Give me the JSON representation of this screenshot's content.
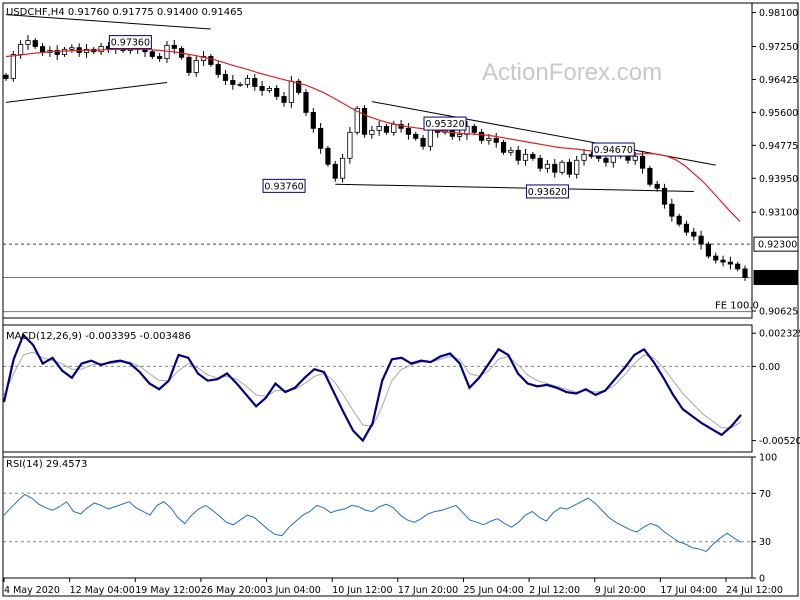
{
  "chart_data": [
    {
      "type": "candlestick",
      "title": "USDCHF,H4  0.91760 0.91775 0.91400 0.91465",
      "watermark": "ActionForex.com",
      "ylim": [
        0.9045,
        0.9834
      ],
      "yticks": [
        "0.98100",
        "0.97250",
        "0.96425",
        "0.95600",
        "0.94775",
        "0.93950",
        "0.93100",
        "0.90625"
      ],
      "ytick_values": [
        0.981,
        0.9725,
        0.96425,
        0.956,
        0.94775,
        0.9395,
        0.931,
        0.90625
      ],
      "xticks": [
        "4 May 2020",
        "12 May 04:00",
        "19 May 12:00",
        "26 May 20:00",
        "3 Jun 04:00",
        "10 Jun 12:00",
        "17 Jun 20:00",
        "25 Jun 04:00",
        "2 Jul 12:00",
        "9 Jul 20:00",
        "17 Jul 04:00",
        "24 Jul 12:00"
      ],
      "price_labels": [
        {
          "text": "0.92300",
          "value": 0.923,
          "style": "boxed"
        },
        {
          "text": "0.91465",
          "value": 0.91465,
          "style": "current"
        }
      ],
      "level_lines": [
        {
          "value": 0.923,
          "style": "dashed"
        },
        {
          "value": 0.91465,
          "style": "solid"
        },
        {
          "value": 0.9061,
          "style": "solid",
          "label": "FE 100.0"
        }
      ],
      "annotations": [
        {
          "text": "0.97360",
          "x": 17,
          "value": 0.9736
        },
        {
          "text": "0.95320",
          "x": 60,
          "value": 0.9532
        },
        {
          "text": "0.93760",
          "x": 38,
          "value": 0.9376
        },
        {
          "text": "0.93620",
          "x": 74,
          "value": 0.9362
        },
        {
          "text": "0.94670",
          "x": 83,
          "value": 0.9467
        }
      ],
      "trendlines": [
        {
          "name": "upper-triangle",
          "from": [
            0,
            0.9805
          ],
          "to": [
            28,
            0.9769
          ]
        },
        {
          "name": "lower-triangle",
          "from": [
            0,
            0.9585
          ],
          "to": [
            22,
            0.9635
          ]
        },
        {
          "name": "falling-resistance",
          "from": [
            50,
            0.9587
          ],
          "to": [
            97,
            0.9428
          ]
        },
        {
          "name": "support",
          "from": [
            45,
            0.938
          ],
          "to": [
            94,
            0.9362
          ]
        }
      ],
      "series": [
        {
          "name": "Close",
          "values": [
            0.9645,
            0.9705,
            0.973,
            0.974,
            0.9725,
            0.971,
            0.9715,
            0.9705,
            0.9718,
            0.9722,
            0.971,
            0.9718,
            0.9712,
            0.9725,
            0.972,
            0.9728,
            0.9715,
            0.9718,
            0.9725,
            0.9712,
            0.97,
            0.9695,
            0.9728,
            0.972,
            0.9698,
            0.966,
            0.969,
            0.97,
            0.968,
            0.9655,
            0.964,
            0.963,
            0.963,
            0.9645,
            0.9625,
            0.9615,
            0.962,
            0.96,
            0.9585,
            0.9638,
            0.961,
            0.956,
            0.952,
            0.947,
            0.943,
            0.9395,
            0.9445,
            0.951,
            0.957,
            0.9505,
            0.9515,
            0.9525,
            0.951,
            0.953,
            0.952,
            0.9505,
            0.9495,
            0.9475,
            0.952,
            0.951,
            0.9515,
            0.95,
            0.9505,
            0.9525,
            0.951,
            0.949,
            0.9495,
            0.9485,
            0.946,
            0.9465,
            0.944,
            0.9455,
            0.9445,
            0.942,
            0.943,
            0.941,
            0.9435,
            0.9405,
            0.944,
            0.9455,
            0.945,
            0.9445,
            0.9435,
            0.9455,
            0.945,
            0.944,
            0.945,
            0.942,
            0.938,
            0.937,
            0.933,
            0.93,
            0.928,
            0.926,
            0.925,
            0.923,
            0.92,
            0.919,
            0.9185,
            0.918,
            0.9168,
            0.91465
          ]
        },
        {
          "name": "MA",
          "color": "#e02020",
          "values": [
            0.97,
            0.9702,
            0.9705,
            0.9708,
            0.971,
            0.9712,
            0.9713,
            0.9714,
            0.9715,
            0.9716,
            0.9716,
            0.9717,
            0.9718,
            0.9718,
            0.9718,
            0.9718,
            0.9717,
            0.9715,
            0.9713,
            0.971,
            0.9706,
            0.9702,
            0.9697,
            0.9692,
            0.9685,
            0.9678,
            0.9672,
            0.9665,
            0.9658,
            0.9652,
            0.9646,
            0.964,
            0.9635,
            0.9629,
            0.962,
            0.961,
            0.9598,
            0.9585,
            0.9572,
            0.956,
            0.955,
            0.9542,
            0.9535,
            0.953,
            0.9525,
            0.9522,
            0.9519,
            0.9516,
            0.9513,
            0.951,
            0.9508,
            0.9506,
            0.9505,
            0.9503,
            0.95,
            0.9496,
            0.9492,
            0.9488,
            0.9484,
            0.948,
            0.9476,
            0.9472,
            0.947,
            0.9468,
            0.9465,
            0.9462,
            0.946,
            0.9458,
            0.9456,
            0.9455,
            0.9456,
            0.9457,
            0.9455,
            0.945,
            0.944,
            0.9425,
            0.9405,
            0.9385,
            0.936,
            0.9335,
            0.931,
            0.9287
          ]
        }
      ]
    },
    {
      "type": "line",
      "title": "MACD(12,26,9) -0.003395 -0.003486",
      "ylim": [
        -0.006,
        0.0029
      ],
      "yticks": [
        "0.002325",
        "0.00",
        "-0.005201"
      ],
      "ytick_values": [
        0.002325,
        0.0,
        -0.005201
      ],
      "zero_line": 0.0,
      "series": [
        {
          "name": "MACD",
          "color": "#000080",
          "values": [
            -0.0025,
            0.0005,
            0.0022,
            0.0015,
            0.0002,
            0.0006,
            -0.0003,
            -0.0008,
            0.0002,
            0.0004,
            0.0001,
            0.0003,
            0.0004,
            0.0002,
            -0.0004,
            -0.0012,
            -0.0016,
            -0.001,
            0.0008,
            0.0006,
            -0.0005,
            -0.001,
            -0.0009,
            -0.0005,
            -0.0012,
            -0.002,
            -0.0028,
            -0.0022,
            -0.0012,
            -0.0018,
            -0.0015,
            -0.0008,
            -0.0002,
            -0.0004,
            -0.0018,
            -0.0032,
            -0.0045,
            -0.0052,
            -0.004,
            -0.001,
            0.0005,
            0.0006,
            0.0002,
            0.0004,
            0.0003,
            0.0007,
            0.0009,
            0.0002,
            -0.0015,
            -0.0008,
            0.0002,
            0.0012,
            0.0008,
            -0.0005,
            -0.0012,
            -0.0014,
            -0.0013,
            -0.0015,
            -0.0018,
            -0.0019,
            -0.0016,
            -0.002,
            -0.0017,
            -0.0009,
            -0.0001,
            0.0008,
            0.0012,
            0.0003,
            -0.0008,
            -0.002,
            -0.003,
            -0.0035,
            -0.004,
            -0.0044,
            -0.0048,
            -0.0042,
            -0.0034
          ]
        },
        {
          "name": "Signal",
          "color": "#a8a8a8",
          "values": [
            -0.002,
            -0.0005,
            0.0008,
            0.001,
            0.0006,
            0.0004,
            0.0002,
            -0.0002,
            -0.0002,
            0.0001,
            0.0002,
            0.0002,
            0.0003,
            0.0003,
            0.0,
            -0.0005,
            -0.001,
            -0.001,
            -0.0003,
            0.0002,
            -0.0001,
            -0.0006,
            -0.0008,
            -0.0007,
            -0.0009,
            -0.0014,
            -0.002,
            -0.0021,
            -0.0017,
            -0.0017,
            -0.0016,
            -0.0012,
            -0.0007,
            -0.0005,
            -0.001,
            -0.002,
            -0.0031,
            -0.0041,
            -0.0042,
            -0.0028,
            -0.001,
            -0.0002,
            0.0001,
            0.0003,
            0.0003,
            0.0005,
            0.0007,
            0.0005,
            -0.0005,
            -0.0007,
            -0.0003,
            0.0005,
            0.0007,
            0.0001,
            -0.0006,
            -0.001,
            -0.0012,
            -0.0014,
            -0.0016,
            -0.0018,
            -0.0017,
            -0.0018,
            -0.0017,
            -0.0013,
            -0.0006,
            0.0002,
            0.0008,
            0.0006,
            -0.0001,
            -0.001,
            -0.0019,
            -0.0026,
            -0.0033,
            -0.0038,
            -0.0043,
            -0.0043,
            -0.0039
          ]
        }
      ]
    },
    {
      "type": "line",
      "title": "RSI(14) 29.4573",
      "ylim": [
        0,
        100
      ],
      "yticks": [
        "100",
        "70",
        "30",
        "0"
      ],
      "ytick_values": [
        100,
        70,
        30,
        0
      ],
      "levels": [
        70,
        30
      ],
      "series": [
        {
          "name": "RSI",
          "color": "#1e6fd0",
          "values": [
            52,
            58,
            64,
            69,
            66,
            61,
            58,
            56,
            59,
            63,
            55,
            53,
            58,
            62,
            60,
            57,
            59,
            61,
            63,
            58,
            55,
            52,
            60,
            63,
            58,
            50,
            45,
            52,
            57,
            60,
            56,
            51,
            46,
            44,
            48,
            52,
            50,
            45,
            40,
            36,
            35,
            42,
            47,
            52,
            55,
            60,
            58,
            54,
            56,
            57,
            60,
            59,
            56,
            55,
            59,
            61,
            58,
            52,
            48,
            46,
            49,
            53,
            55,
            56,
            58,
            60,
            54,
            48,
            46,
            44,
            47,
            49,
            45,
            42,
            46,
            52,
            55,
            50,
            47,
            54,
            58,
            57,
            60,
            63,
            66,
            62,
            56,
            50,
            46,
            43,
            40,
            38,
            42,
            45,
            43,
            38,
            34,
            30,
            28,
            25,
            24,
            22,
            28,
            33,
            37,
            33,
            29.5
          ]
        }
      ]
    }
  ]
}
